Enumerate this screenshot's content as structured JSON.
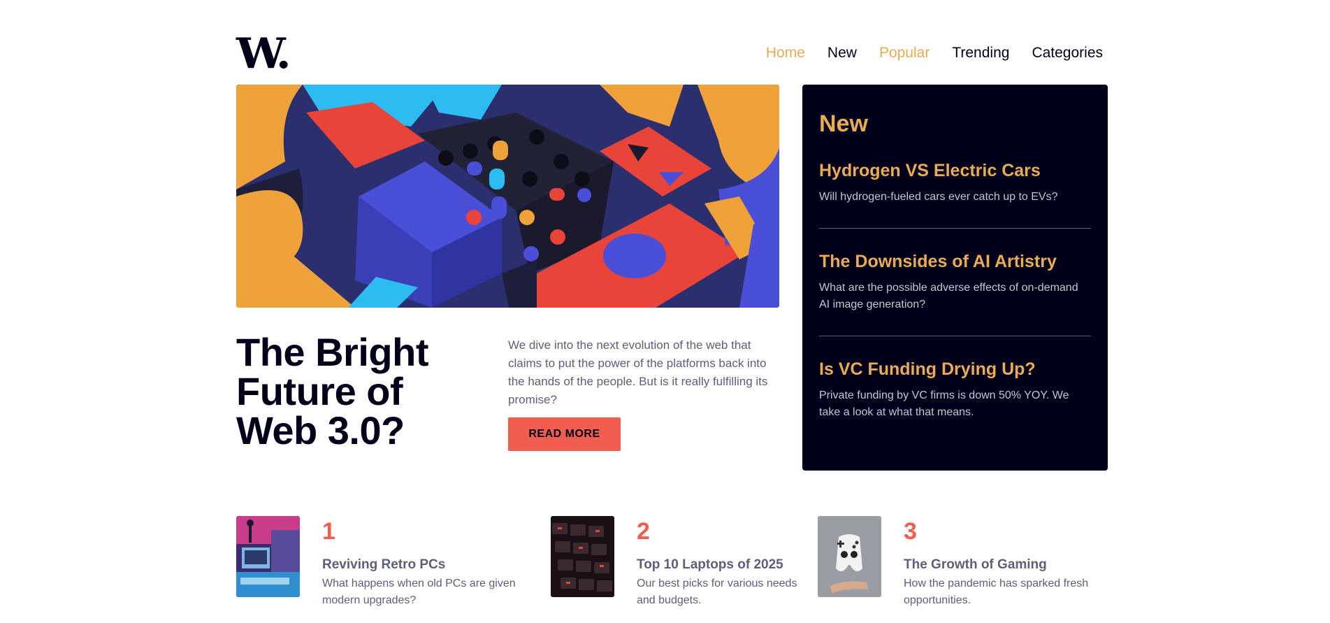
{
  "header": {
    "logo_text": "W.",
    "nav": [
      {
        "label": "Home"
      },
      {
        "label": "New"
      },
      {
        "label": "Popular"
      },
      {
        "label": "Trending"
      },
      {
        "label": "Categories"
      }
    ]
  },
  "hero": {
    "image_icon": "abstract-blocks-image",
    "title_line1": "The Bright",
    "title_line2": "Future of",
    "title_line3": "Web 3.0?",
    "description": "We dive into the next evolution of the web that claims to put the power of the platforms back into the hands of the people. But is it really fulfilling its promise?",
    "button_label": "READ MORE"
  },
  "new_panel": {
    "heading": "New",
    "items": [
      {
        "title": "Hydrogen VS Electric Cars",
        "desc": "Will hydrogen-fueled cars ever catch up to EVs?"
      },
      {
        "title": "The Downsides of AI Artistry",
        "desc": "What are the possible adverse effects of on-demand AI image generation?"
      },
      {
        "title": "Is VC Funding Drying Up?",
        "desc": "Private funding by VC firms is down 50% YOY. We take a look at what that means."
      }
    ]
  },
  "bottom": [
    {
      "num": "1",
      "title": "Reviving Retro PCs",
      "desc": "What happens when old PCs are given modern upgrades?",
      "image_icon": "retro-pc-image"
    },
    {
      "num": "2",
      "title": "Top 10 Laptops of 2025",
      "desc": "Our best picks for various needs and budgets.",
      "image_icon": "laptop-keyboard-image"
    },
    {
      "num": "3",
      "title": "The Growth of Gaming",
      "desc": "How the pandemic has sparked fresh opportunities.",
      "image_icon": "game-controller-image"
    }
  ],
  "colors": {
    "accent_orange": "#e9ab53",
    "accent_red": "#f15e50",
    "dark_navy": "#00001a",
    "grey_text": "#5d5f79"
  }
}
